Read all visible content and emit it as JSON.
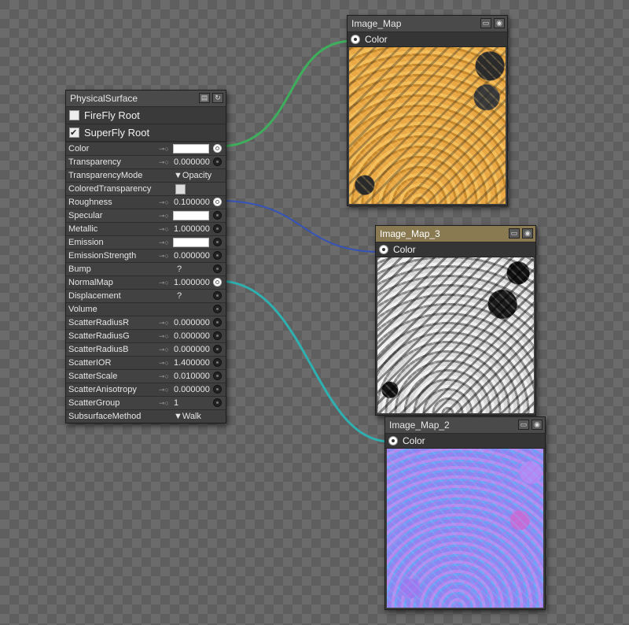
{
  "colors": {
    "wire_color": "#3fae5c",
    "wire_roughness": "#3553b8",
    "wire_normalmap": "#2fb0b0",
    "selected_title": "#8a7a52"
  },
  "physical_surface": {
    "title": "PhysicalSurface",
    "roots": [
      {
        "label": "FireFly Root",
        "checked": false
      },
      {
        "label": "SuperFly Root",
        "checked": true
      }
    ],
    "params": [
      {
        "label": "Color",
        "key": true,
        "value": "",
        "kind": "swatch",
        "port": "connected"
      },
      {
        "label": "Transparency",
        "key": true,
        "value": "0.000000",
        "kind": "number",
        "port": "open"
      },
      {
        "label": "TransparencyMode",
        "key": false,
        "value": "▼Opacity",
        "kind": "mode",
        "port": "none"
      },
      {
        "label": "ColoredTransparency",
        "key": false,
        "value": "",
        "kind": "checkbox",
        "port": "none"
      },
      {
        "label": "Roughness",
        "key": true,
        "value": "0.100000",
        "kind": "number",
        "port": "connected"
      },
      {
        "label": "Specular",
        "key": true,
        "value": "",
        "kind": "swatch",
        "port": "open"
      },
      {
        "label": "Metallic",
        "key": true,
        "value": "1.000000",
        "kind": "number",
        "port": "open"
      },
      {
        "label": "Emission",
        "key": true,
        "value": "",
        "kind": "swatch",
        "port": "open"
      },
      {
        "label": "EmissionStrength",
        "key": true,
        "value": "0.000000",
        "kind": "number",
        "port": "open"
      },
      {
        "label": "Bump",
        "key": false,
        "value": "?",
        "kind": "q",
        "port": "open"
      },
      {
        "label": "NormalMap",
        "key": true,
        "value": "1.000000",
        "kind": "number",
        "port": "connected"
      },
      {
        "label": "Displacement",
        "key": false,
        "value": "?",
        "kind": "q",
        "port": "open"
      },
      {
        "label": "Volume",
        "key": false,
        "value": "",
        "kind": "empty",
        "port": "open"
      },
      {
        "label": "ScatterRadiusR",
        "key": true,
        "value": "0.000000",
        "kind": "number",
        "port": "open"
      },
      {
        "label": "ScatterRadiusG",
        "key": true,
        "value": "0.000000",
        "kind": "number",
        "port": "open"
      },
      {
        "label": "ScatterRadiusB",
        "key": true,
        "value": "0.000000",
        "kind": "number",
        "port": "open"
      },
      {
        "label": "ScatterIOR",
        "key": true,
        "value": "1.400000",
        "kind": "number",
        "port": "open"
      },
      {
        "label": "ScatterScale",
        "key": true,
        "value": "0.010000",
        "kind": "number",
        "port": "open"
      },
      {
        "label": "ScatterAnisotropy",
        "key": true,
        "value": "0.000000",
        "kind": "number",
        "port": "open"
      },
      {
        "label": "ScatterGroup",
        "key": true,
        "value": "1",
        "kind": "number",
        "port": "open"
      },
      {
        "label": "SubsurfaceMethod",
        "key": false,
        "value": "▼Walk",
        "kind": "mode",
        "port": "none"
      }
    ]
  },
  "image_maps": [
    {
      "id": "im1",
      "title": "Image_Map",
      "output": "Color",
      "selected": false
    },
    {
      "id": "im3",
      "title": "Image_Map_3",
      "output": "Color",
      "selected": true
    },
    {
      "id": "im2",
      "title": "Image_Map_2",
      "output": "Color",
      "selected": false
    }
  ]
}
